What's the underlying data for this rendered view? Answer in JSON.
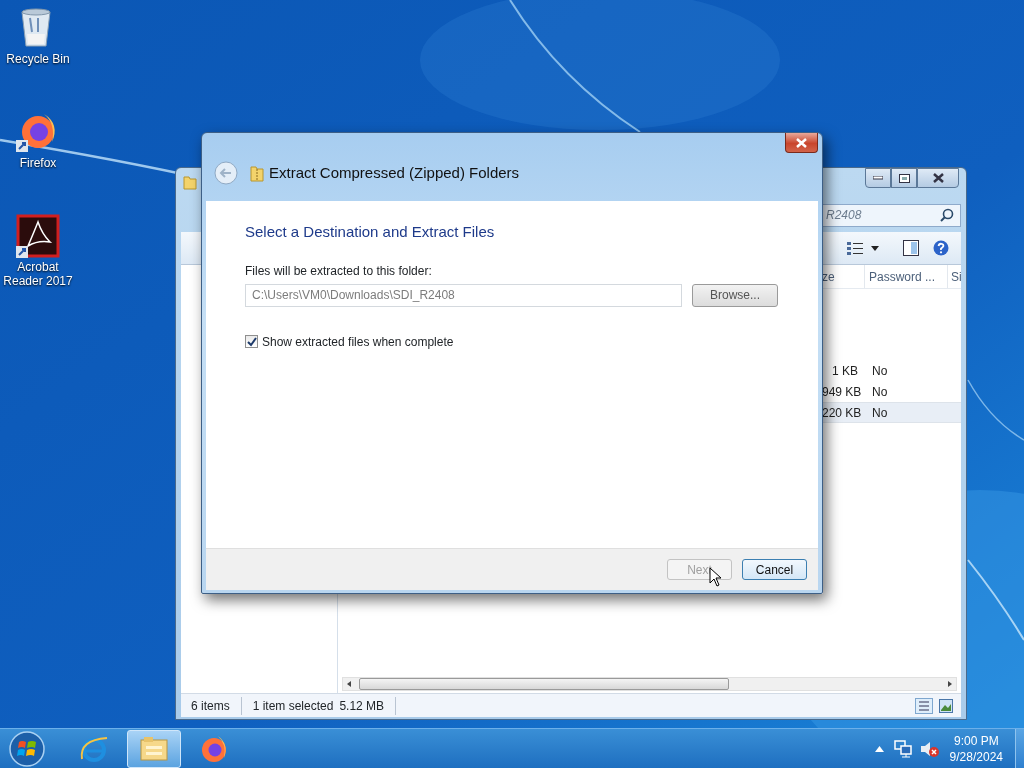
{
  "desktop": {
    "icons": [
      {
        "kind": "recycle",
        "label": "Recycle Bin"
      },
      {
        "kind": "firefox",
        "label": "Firefox"
      },
      {
        "kind": "acrobat",
        "label": "Acrobat Reader 2017"
      }
    ]
  },
  "explorer": {
    "search": {
      "value": "R2408"
    },
    "columns": [
      "ze",
      "Password ...",
      "Si"
    ],
    "rows": [
      {
        "size": "1 KB",
        "password": "No",
        "selected": false
      },
      {
        "size": "949 KB",
        "password": "No",
        "selected": false
      },
      {
        "size": "220 KB",
        "password": "No",
        "selected": true
      }
    ],
    "status": {
      "items": "6 items",
      "selection": "1 item selected",
      "size": "5.12 MB"
    }
  },
  "dialog": {
    "title": "Extract Compressed (Zipped) Folders",
    "heading": "Select a Destination and Extract Files",
    "folder_label": "Files will be extracted to this folder:",
    "path": "C:\\Users\\VM0\\Downloads\\SDI_R2408",
    "browse": "Browse...",
    "show_files": {
      "label": "Show extracted files when complete",
      "checked": true
    },
    "buttons": [
      {
        "label": "Next",
        "disabled": true
      },
      {
        "label": "Cancel",
        "disabled": false
      }
    ]
  },
  "taskbar": {
    "apps": [
      {
        "kind": "ie",
        "selected": false
      },
      {
        "kind": "explorer",
        "selected": true
      },
      {
        "kind": "firefox",
        "selected": false
      }
    ],
    "time": "9:00 PM",
    "date": "9/28/2024"
  }
}
